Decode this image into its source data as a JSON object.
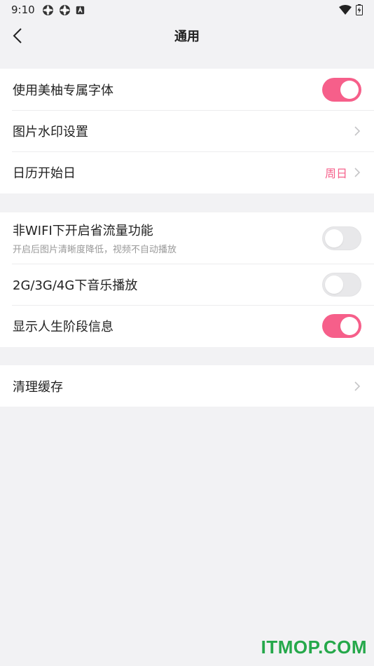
{
  "status_bar": {
    "time": "9:10",
    "icons": [
      "sync-icon",
      "sync-icon",
      "a-badge-icon"
    ],
    "right_icons": [
      "wifi-icon",
      "battery-icon"
    ]
  },
  "nav": {
    "title": "通用",
    "back_icon": "chevron-left-icon"
  },
  "colors": {
    "accent": "#f65f8a",
    "toggle_off": "#e8e8ea",
    "background": "#f2f2f4"
  },
  "group1": {
    "font": {
      "label": "使用美柚专属字体",
      "toggle": true
    },
    "watermark": {
      "label": "图片水印设置",
      "chevron": "chevron-right-icon"
    },
    "calendar": {
      "label": "日历开始日",
      "value": "周日",
      "chevron": "chevron-right-icon"
    }
  },
  "group2": {
    "saver": {
      "label": "非WIFI下开启省流量功能",
      "sub": "开启后图片清晰度降低，视频不自动播放",
      "toggle": false
    },
    "music": {
      "label": "2G/3G/4G下音乐播放",
      "toggle": false
    },
    "stage": {
      "label": "显示人生阶段信息",
      "toggle": true
    }
  },
  "group3": {
    "cache": {
      "label": "清理缓存",
      "chevron": "chevron-right-icon"
    }
  },
  "watermark_text": "ITMOP.COM"
}
